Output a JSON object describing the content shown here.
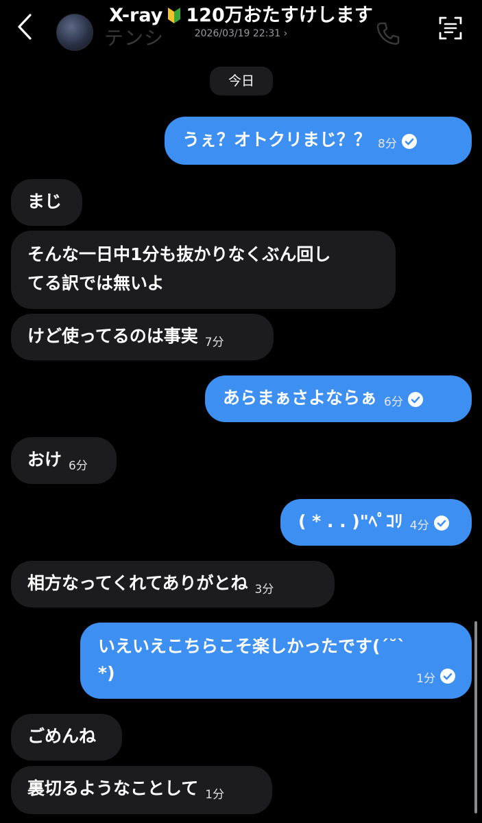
{
  "header": {
    "title_prefix": "X-ray",
    "title_suffix": "120万おたすけします",
    "subtitle": "2026/03/19 22:31 ›",
    "ghost_name": "テンシ"
  },
  "date_divider": "今日",
  "messages": [
    {
      "dir": "out",
      "text": "うぇ？オトクリまじ？？",
      "time": "8分",
      "read": true
    },
    {
      "dir": "in",
      "text": "まじ"
    },
    {
      "dir": "in",
      "lines": [
        "そんな一日中1分も抜かりなくぶん回し",
        "てる訳では無いよ"
      ]
    },
    {
      "dir": "in",
      "text": "けど使ってるのは事実",
      "time": "7分"
    },
    {
      "dir": "out",
      "text": "あらまぁさよならぁ",
      "time": "6分",
      "read": true
    },
    {
      "dir": "in",
      "text": "おけ",
      "time": "6分"
    },
    {
      "dir": "out",
      "text": "( * . . )\"ﾍﾟｺﾘ",
      "time": "4分",
      "read": true
    },
    {
      "dir": "in",
      "text": "相方なってくれてありがとね",
      "time": "3分"
    },
    {
      "dir": "out",
      "lines": [
        "いえいえこちらこそ楽しかったです(´˘`",
        "*)"
      ],
      "time": "1分",
      "read": true
    },
    {
      "dir": "in",
      "text": "ごめんね"
    },
    {
      "dir": "in",
      "text": "裏切るようなことして",
      "time": "1分"
    }
  ],
  "colors": {
    "background": "#000000",
    "incoming_bubble": "#1c1c1e",
    "outgoing_bubble": "#3d8ff2"
  },
  "icons": [
    "back-arrow-icon",
    "beginner-mark-icon",
    "phone-icon",
    "video-icon",
    "scan-icon",
    "read-check-icon"
  ]
}
